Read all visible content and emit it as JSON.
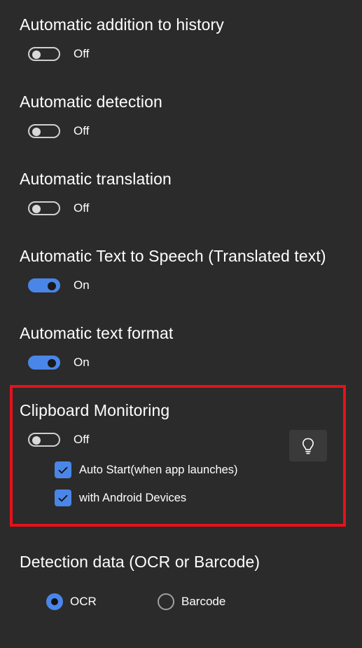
{
  "settings": [
    {
      "title": "Automatic addition to history",
      "state": "Off"
    },
    {
      "title": "Automatic detection",
      "state": "Off"
    },
    {
      "title": "Automatic translation",
      "state": "Off"
    },
    {
      "title": "Automatic Text to Speech (Translated text)",
      "state": "On"
    },
    {
      "title": "Automatic text format",
      "state": "On"
    }
  ],
  "clipboard": {
    "title": "Clipboard Monitoring",
    "state": "Off",
    "hint_icon": "lightbulb-icon",
    "options": [
      {
        "label": "Auto Start(when app launches)",
        "checked": true
      },
      {
        "label": "with Android Devices",
        "checked": true
      }
    ]
  },
  "detection": {
    "title": "Detection data (OCR or Barcode)",
    "options": [
      {
        "label": "OCR",
        "selected": true
      },
      {
        "label": "Barcode",
        "selected": false
      }
    ]
  },
  "colors": {
    "background": "#2b2b2b",
    "accent": "#4a86e8",
    "highlight": "#e8101a"
  }
}
